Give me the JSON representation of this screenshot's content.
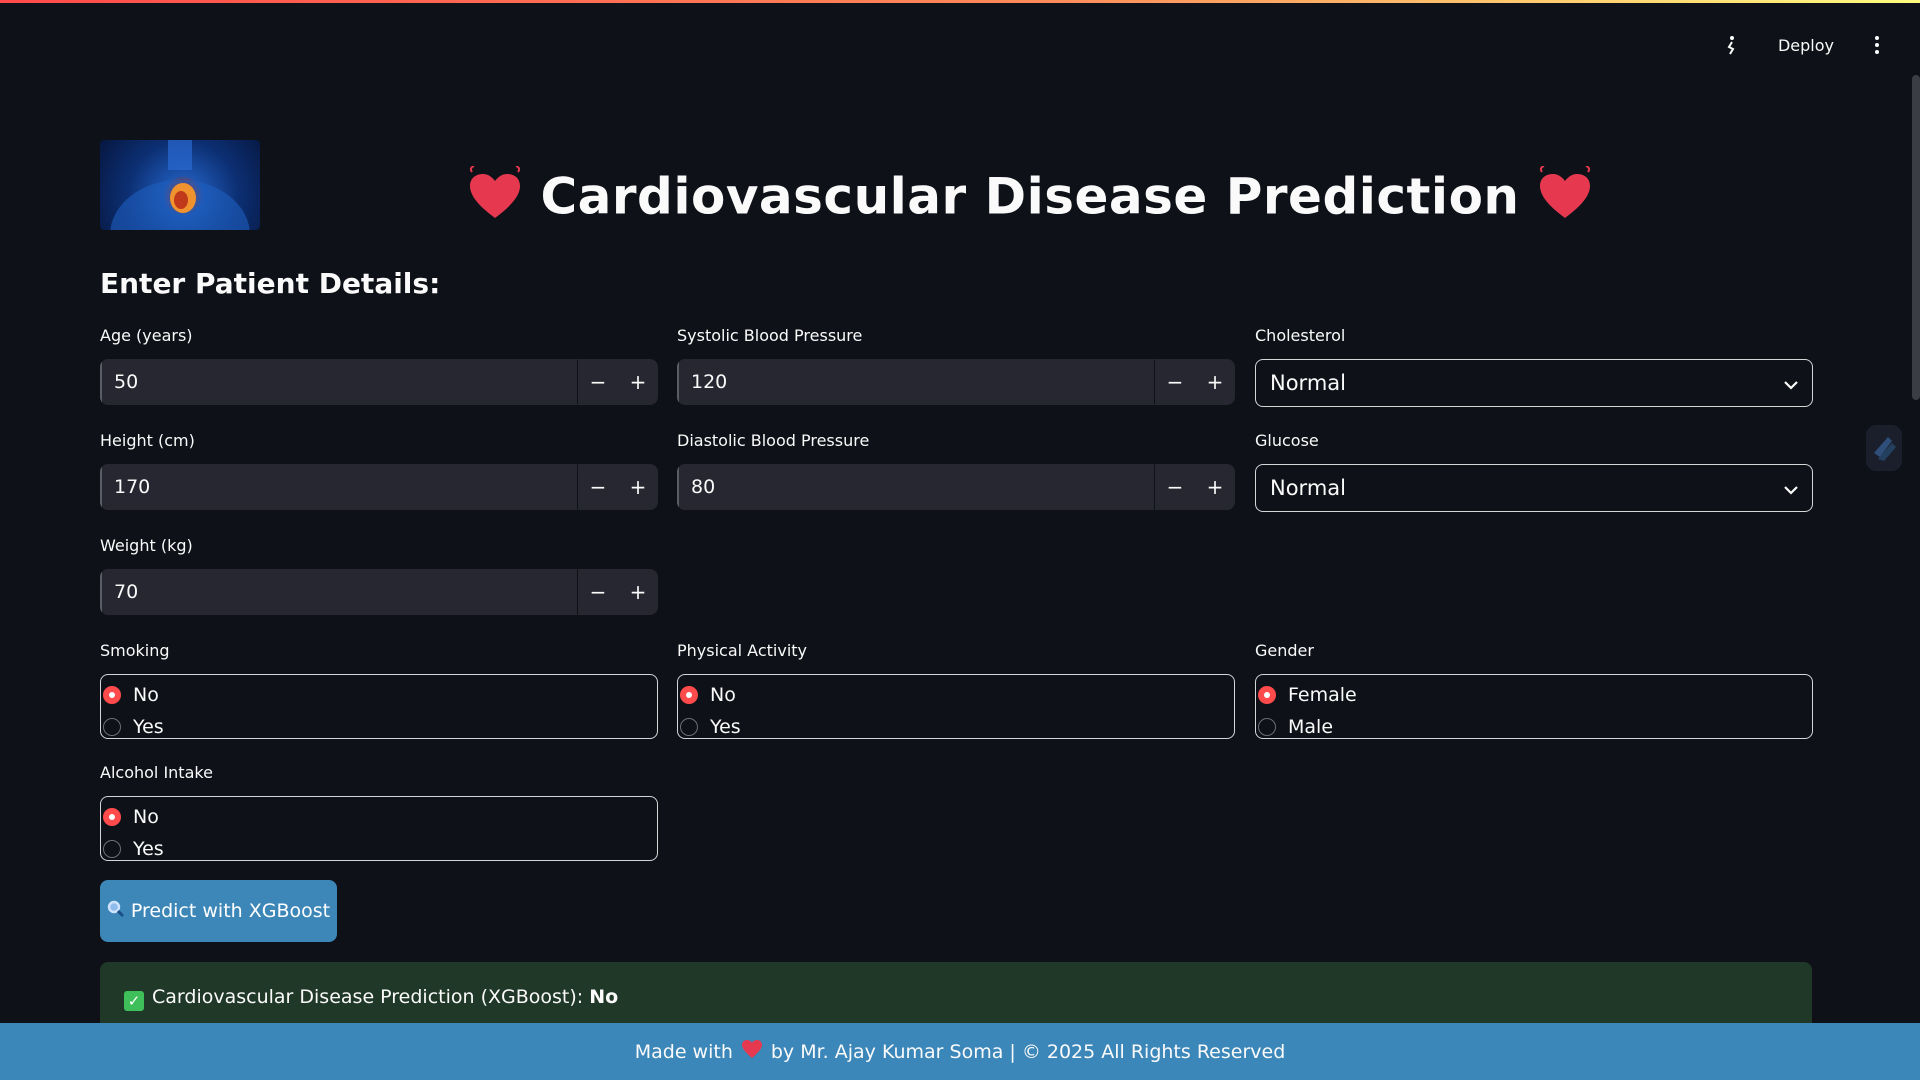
{
  "header": {
    "deploy_label": "Deploy"
  },
  "title": {
    "text": "Cardiovascular Disease Prediction"
  },
  "section": {
    "heading": "Enter Patient Details:"
  },
  "fields": {
    "age": {
      "label": "Age (years)",
      "value": "50"
    },
    "height": {
      "label": "Height (cm)",
      "value": "170"
    },
    "weight": {
      "label": "Weight (kg)",
      "value": "70"
    },
    "systolic": {
      "label": "Systolic Blood Pressure",
      "value": "120"
    },
    "diastolic": {
      "label": "Diastolic Blood Pressure",
      "value": "80"
    },
    "cholesterol": {
      "label": "Cholesterol",
      "value": "Normal"
    },
    "glucose": {
      "label": "Glucose",
      "value": "Normal"
    }
  },
  "radios": {
    "smoking": {
      "label": "Smoking",
      "options": [
        "No",
        "Yes"
      ],
      "selected": "No"
    },
    "activity": {
      "label": "Physical Activity",
      "options": [
        "No",
        "Yes"
      ],
      "selected": "No"
    },
    "gender": {
      "label": "Gender",
      "options": [
        "Female",
        "Male"
      ],
      "selected": "Female"
    },
    "alcohol": {
      "label": "Alcohol Intake",
      "options": [
        "No",
        "Yes"
      ],
      "selected": "No"
    }
  },
  "predict_button": {
    "label": "Predict with XGBoost"
  },
  "result": {
    "prefix": "Cardiovascular Disease Prediction (XGBoost):",
    "value": "No"
  },
  "footer": {
    "made_with": "Made with",
    "rest": "by Mr. Ajay Kumar Soma | © 2025 All Rights Reserved"
  },
  "colors": {
    "accent": "#ff4b4b",
    "button": "#3d87b8",
    "success_bg": "#203827",
    "footer_bg": "#3b87b9"
  }
}
